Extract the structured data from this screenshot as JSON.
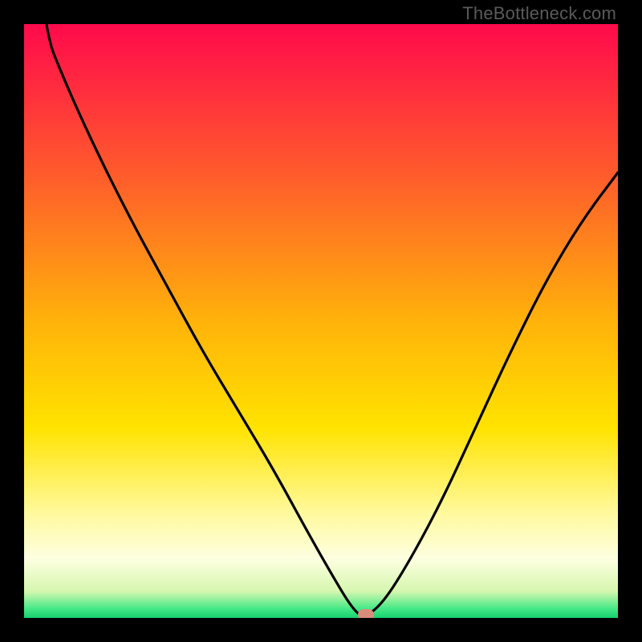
{
  "watermark": "TheBottleneck.com",
  "chart_data": {
    "type": "line",
    "title": "",
    "xlabel": "",
    "ylabel": "",
    "xlim": [
      0,
      100
    ],
    "ylim": [
      0,
      100
    ],
    "grid": false,
    "legend": false,
    "background_gradient": {
      "stops": [
        {
          "pos": 0.0,
          "color": "#ff0a4c"
        },
        {
          "pos": 0.25,
          "color": "#ff5a2c"
        },
        {
          "pos": 0.5,
          "color": "#ffb20a"
        },
        {
          "pos": 0.68,
          "color": "#ffe300"
        },
        {
          "pos": 0.82,
          "color": "#fff99a"
        },
        {
          "pos": 0.9,
          "color": "#fdffe0"
        },
        {
          "pos": 0.955,
          "color": "#d6f7b0"
        },
        {
          "pos": 0.985,
          "color": "#42e885"
        },
        {
          "pos": 1.0,
          "color": "#17d06e"
        }
      ]
    },
    "curve": {
      "description": "V-shaped bottleneck curve; minimum near x≈57, y≈0",
      "x": [
        0,
        3,
        7,
        12,
        18,
        24,
        30,
        36,
        42,
        48,
        52,
        55,
        57,
        60,
        64,
        70,
        76,
        82,
        88,
        94,
        100
      ],
      "y": [
        130,
        100,
        90,
        79,
        67,
        56,
        45,
        35,
        25,
        14,
        7,
        2,
        0,
        2,
        8,
        19,
        32,
        45,
        57,
        67,
        75
      ]
    },
    "marker": {
      "x": 57.5,
      "y": 0,
      "color": "#d98b7c"
    }
  }
}
